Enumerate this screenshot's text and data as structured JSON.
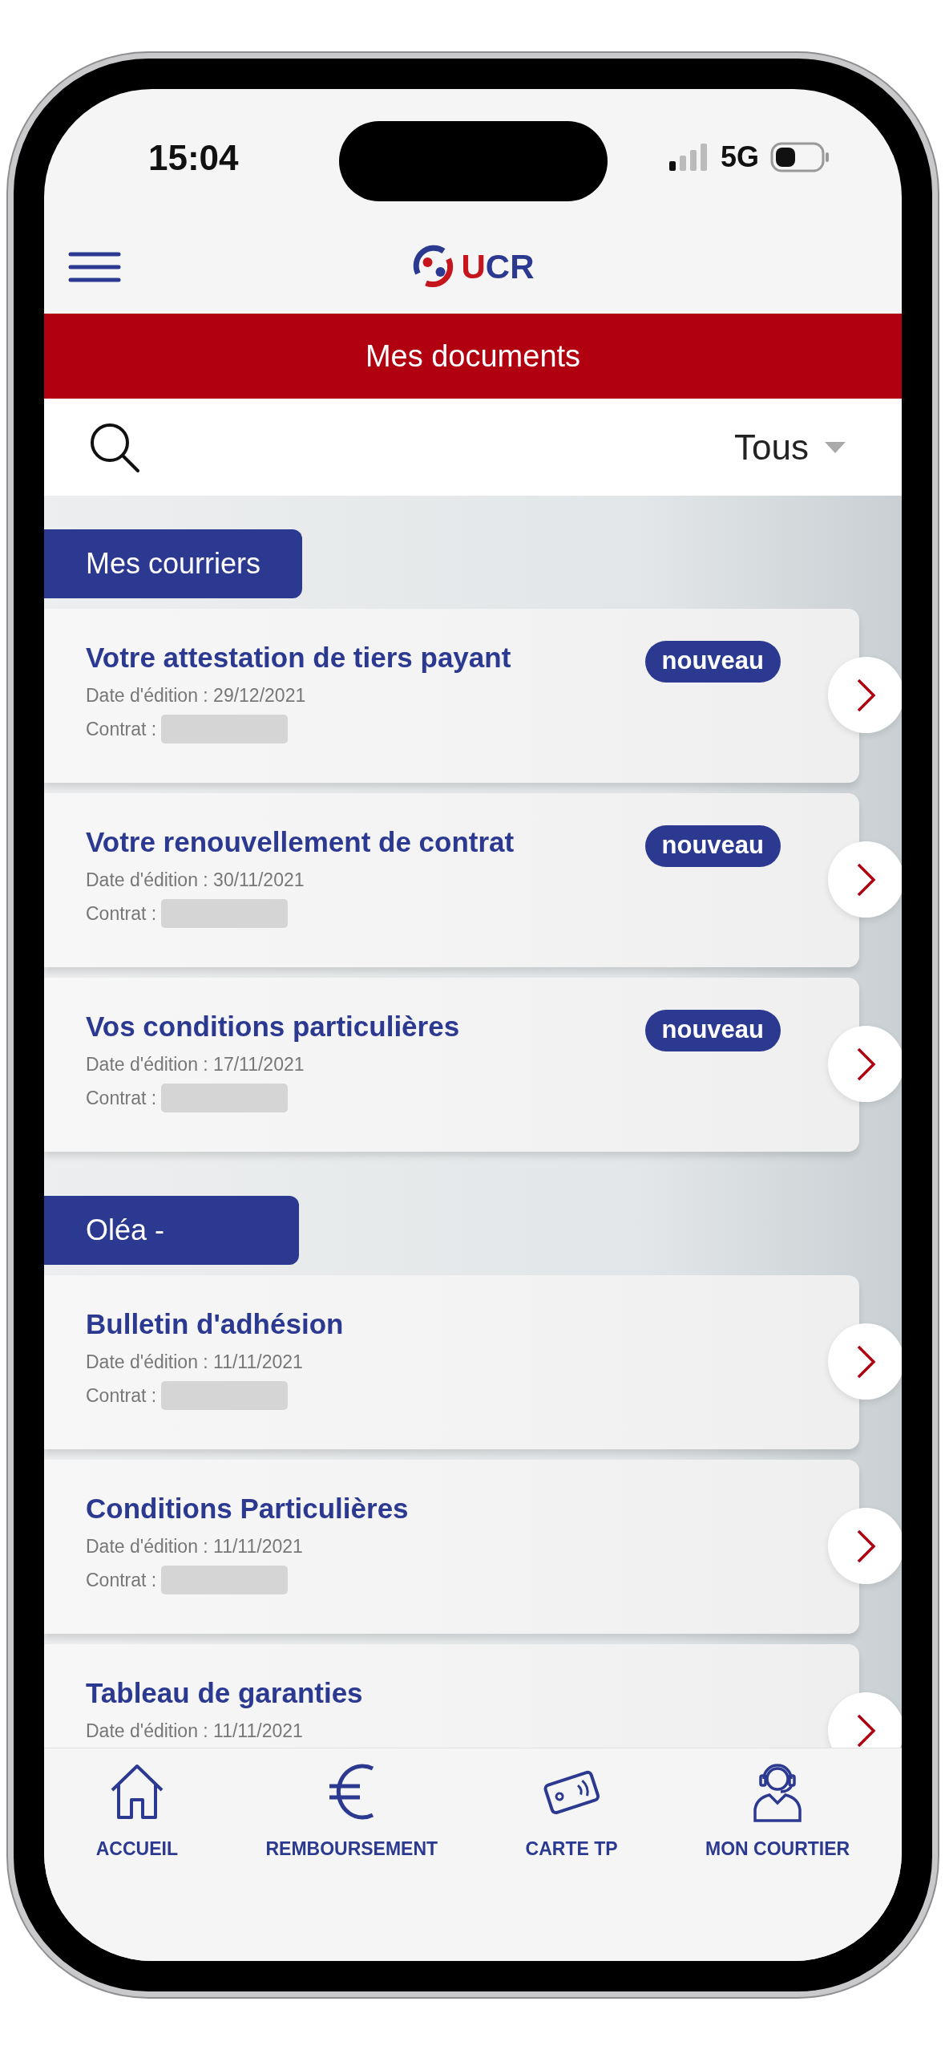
{
  "status_bar": {
    "time": "15:04",
    "network": "5G"
  },
  "app_bar": {
    "logo_text": "UCR"
  },
  "title_bar": {
    "title": "Mes documents"
  },
  "filter": {
    "value": "Tous"
  },
  "sections": [
    {
      "title": "Mes courriers",
      "documents": [
        {
          "title": "Votre attestation de tiers payant",
          "badge": "nouveau",
          "date": "Date d'édition : 29/12/2021",
          "contract_label": "Contrat :"
        },
        {
          "title": "Votre renouvellement de contrat",
          "badge": "nouveau",
          "date": "Date d'édition : 30/11/2021",
          "contract_label": "Contrat :"
        },
        {
          "title": "Vos conditions particulières",
          "badge": "nouveau",
          "date": "Date d'édition : 17/11/2021",
          "contract_label": "Contrat :"
        }
      ]
    },
    {
      "title": "Oléa -",
      "documents": [
        {
          "title": "Bulletin d'adhésion",
          "date": "Date d'édition : 11/11/2021",
          "contract_label": "Contrat :"
        },
        {
          "title": "Conditions Particulières",
          "date": "Date d'édition : 11/11/2021",
          "contract_label": "Contrat :"
        },
        {
          "title": "Tableau de garanties",
          "date": "Date d'édition : 11/11/2021"
        }
      ]
    }
  ],
  "bottom_nav": [
    {
      "label": "ACCUEIL"
    },
    {
      "label": "REMBOURSEMENT"
    },
    {
      "label": "CARTE TP"
    },
    {
      "label": "MON COURTIER"
    }
  ]
}
